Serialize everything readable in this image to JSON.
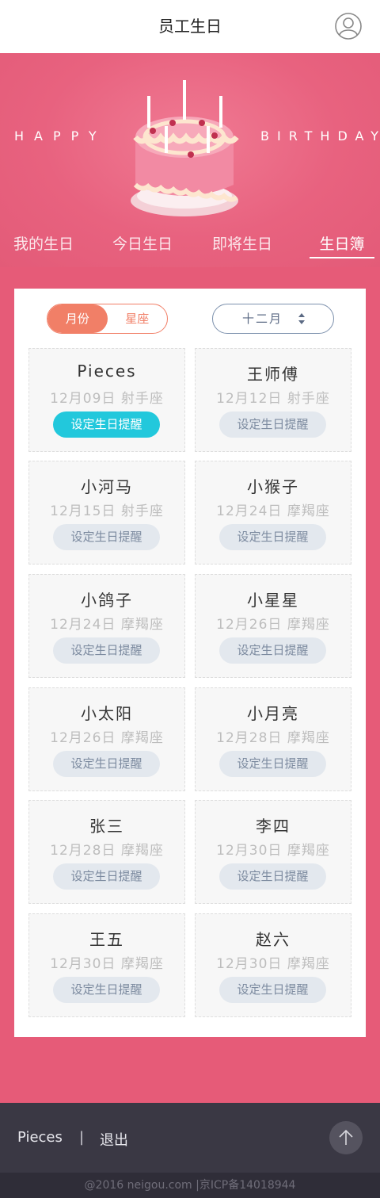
{
  "header": {
    "title": "员工生日"
  },
  "hero": {
    "left_word": "HAPPY",
    "right_word": "BIRTHDAY"
  },
  "tabs": [
    "我的生日",
    "今日生日",
    "即将生日",
    "生日簿"
  ],
  "filter": {
    "seg_month": "月份",
    "seg_zodiac": "星座",
    "month_value": "十二月"
  },
  "people": [
    {
      "name": "Pieces",
      "date": "12月09日",
      "zodiac": "射手座",
      "btn": "设定生日提醒",
      "active": true
    },
    {
      "name": "王师傅",
      "date": "12月12日",
      "zodiac": "射手座",
      "btn": "设定生日提醒",
      "active": false
    },
    {
      "name": "小河马",
      "date": "12月15日",
      "zodiac": "射手座",
      "btn": "设定生日提醒",
      "active": false
    },
    {
      "name": "小猴子",
      "date": "12月24日",
      "zodiac": "摩羯座",
      "btn": "设定生日提醒",
      "active": false
    },
    {
      "name": "小鸽子",
      "date": "12月24日",
      "zodiac": "摩羯座",
      "btn": "设定生日提醒",
      "active": false
    },
    {
      "name": "小星星",
      "date": "12月26日",
      "zodiac": "摩羯座",
      "btn": "设定生日提醒",
      "active": false
    },
    {
      "name": "小太阳",
      "date": "12月26日",
      "zodiac": "摩羯座",
      "btn": "设定生日提醒",
      "active": false
    },
    {
      "name": "小月亮",
      "date": "12月28日",
      "zodiac": "摩羯座",
      "btn": "设定生日提醒",
      "active": false
    },
    {
      "name": "张三",
      "date": "12月28日",
      "zodiac": "摩羯座",
      "btn": "设定生日提醒",
      "active": false
    },
    {
      "name": "李四",
      "date": "12月30日",
      "zodiac": "摩羯座",
      "btn": "设定生日提醒",
      "active": false
    },
    {
      "name": "王五",
      "date": "12月30日",
      "zodiac": "摩羯座",
      "btn": "设定生日提醒",
      "active": false
    },
    {
      "name": "赵六",
      "date": "12月30日",
      "zodiac": "摩羯座",
      "btn": "设定生日提醒",
      "active": false
    }
  ],
  "footer": {
    "user": "Pieces",
    "separator": "|",
    "logout": "退出"
  },
  "copyright": "@2016 neigou.com |京ICP备14018944",
  "colors": {
    "background": "#e65b78",
    "accent": "#f17f67",
    "active_button": "#22c8dc",
    "footer": "#3a3844"
  },
  "icons": {
    "avatar": "user-circle-icon",
    "back_to_top": "arrow-up-icon",
    "month_picker": "sort-arrows-icon",
    "hero": "birthday-cake-icon"
  }
}
